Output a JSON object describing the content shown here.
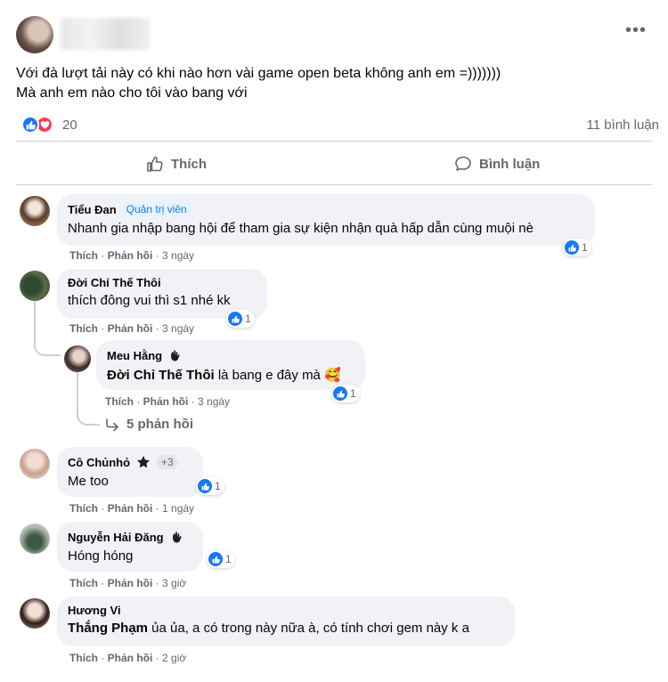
{
  "post": {
    "text_line1": "Với đà lượt tải này có khi nào hơn vài game open beta không anh em =)))))))",
    "text_line2": "Mà anh em nào cho tôi vào bang với",
    "more": "•••",
    "reaction_count": "20",
    "comment_count": "11 bình luận",
    "like_label": "Thích",
    "comment_label": "Bình luận"
  },
  "comments": [
    {
      "name": "Tiểu Đan",
      "badge": "Quản trị viên",
      "text": "Nhanh gia nhập bang hội để tham gia sự kiện nhận quà hấp dẫn cùng muội nè",
      "like": "Thích",
      "reply": "Phản hồi",
      "time": "3 ngày",
      "reactions": "1"
    },
    {
      "name": "Đời Chỉ Thế Thôi",
      "text": "thích đông vui thì s1 nhé kk",
      "like": "Thích",
      "reply": "Phản hồi",
      "time": "3 ngày",
      "reactions": "1"
    },
    {
      "name": "Meu Hằng",
      "mention": "Đời Chỉ Thế Thôi",
      "text": " là bang e đây mà 🥰",
      "like": "Thích",
      "reply": "Phản hồi",
      "time": "3 ngày",
      "reactions": "1"
    },
    {
      "name": "Cô Chủnhỏ",
      "extra": "+3",
      "text": "Me too",
      "like": "Thích",
      "reply": "Phản hồi",
      "time": "1 ngày",
      "reactions": "1"
    },
    {
      "name": "Nguyễn Hải Đăng",
      "text": "Hóng hóng",
      "like": "Thích",
      "reply": "Phản hồi",
      "time": "3 giờ",
      "reactions": "1"
    },
    {
      "name": "Hương Vi",
      "mention": "Thắng Phạm",
      "text": " ủa ủa, a có trong này nữa à, có tính chơi gem này k a",
      "like": "Thích",
      "reply": "Phản hồi",
      "time": "2 giờ"
    }
  ],
  "replies_link": "5 phản hồi",
  "colors": {
    "accent": "#1877f2",
    "love": "#f33e58",
    "bubble": "#f0f2f5",
    "muted": "#65676b"
  }
}
